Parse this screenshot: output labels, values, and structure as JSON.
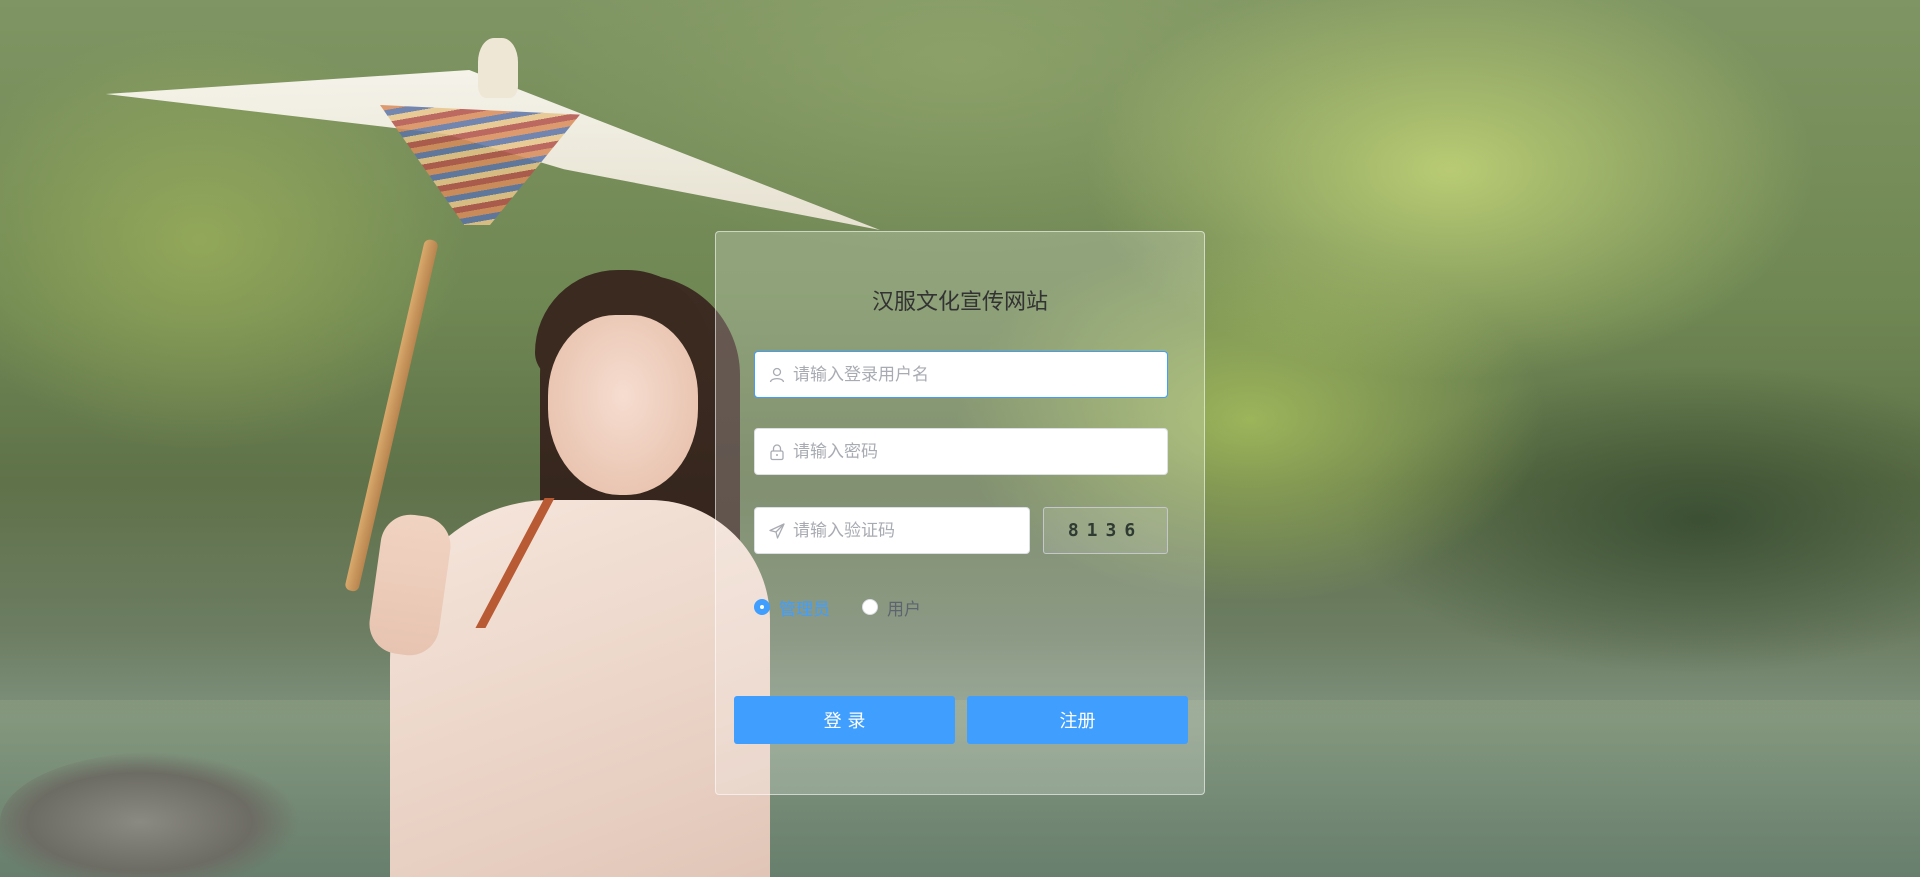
{
  "login": {
    "title": "汉服文化宣传网站",
    "username_placeholder": "请输入登录用户名",
    "password_placeholder": "请输入密码",
    "captcha_placeholder": "请输入验证码",
    "captcha_code": "8136",
    "roles": [
      {
        "label": "管理员",
        "checked": true
      },
      {
        "label": "用户",
        "checked": false
      }
    ],
    "login_button": "登 录",
    "register_button": "注册"
  },
  "colors": {
    "primary": "#409eff",
    "input_focus_border": "#409eff",
    "title_text": "#333333"
  },
  "icons": {
    "username": "user-icon",
    "password": "lock-icon",
    "captcha": "send-icon"
  }
}
